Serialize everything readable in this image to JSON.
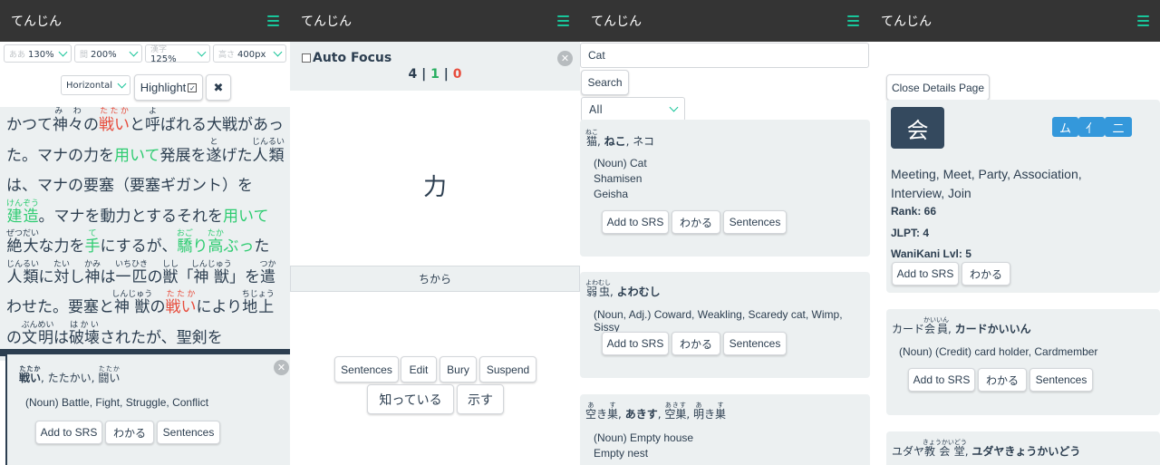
{
  "app": {
    "brand": "てんじん"
  },
  "reader_panel": {
    "settings": [
      {
        "key": "ああ",
        "value": "130%"
      },
      {
        "key": "間",
        "value": "200%"
      },
      {
        "key": "漢字",
        "value": "125%"
      },
      {
        "key": "高さ",
        "value": "400px"
      }
    ],
    "orientation": "Horizontal",
    "highlight_label": "Highlight",
    "close_glyph": "✖",
    "popup": {
      "word": "戦い",
      "word_reading": "たたか",
      "kana": "たたかい",
      "alt": "闘い",
      "alt_reading": "たたか",
      "definition": "(Noun) Battle, Fight, Struggle, Conflict",
      "add_srs": "Add to SRS",
      "wakaru": "わかる",
      "sentences": "Sentences"
    }
  },
  "flashcard_panel": {
    "auto_focus": "Auto Focus",
    "count_total": "4",
    "count_correct": "1",
    "count_wrong": "0",
    "sep": "|",
    "kanji": "力",
    "reading": "ちから",
    "actions": [
      "Sentences",
      "Edit",
      "Bury",
      "Suspend"
    ],
    "know": "知っている",
    "show": "示す",
    "accent_correct": "#27ae60",
    "accent_wrong": "#e74c3c"
  },
  "search_panel": {
    "query": "Cat",
    "search_button": "Search",
    "filter": "All",
    "results": [
      {
        "display": "猫, ねこ, ネコ",
        "defs": [
          "(Noun) Cat",
          "Shamisen",
          "Geisha"
        ]
      },
      {
        "display": "弱虫, よわむし",
        "defs": [
          "(Noun, Adj.) Coward, Weakling, Scaredy cat, Wimp, Sissy"
        ]
      },
      {
        "display": "空き巣, あきす, 空巣, 明き巣",
        "defs": [
          "(Noun) Empty house",
          "Empty nest"
        ]
      }
    ],
    "add_srs": "Add to SRS",
    "wakaru": "わかる",
    "sentences": "Sentences"
  },
  "details_panel": {
    "close_button": "Close Details Page",
    "kanji": "会",
    "components": [
      "ム",
      "亻",
      "二"
    ],
    "meanings": "Meeting, Meet, Party, Association, Interview, Join",
    "rank": "Rank: 66",
    "jlpt": "JLPT: 4",
    "wanikani": "WaniKani Lvl: 5",
    "add_srs": "Add to SRS",
    "wakaru": "わかる",
    "sentences": "Sentences",
    "entries": [
      {
        "display": "カード会員, カードかいいん",
        "def": "(Noun) (Credit) card holder, Cardmember"
      },
      {
        "display": "ユダヤ教会堂, ユダヤきょうかいどう"
      }
    ]
  }
}
